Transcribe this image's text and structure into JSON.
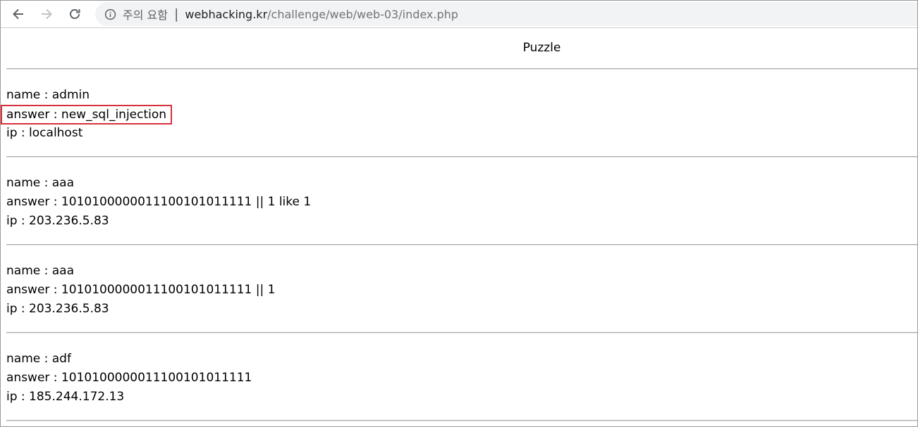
{
  "browser": {
    "security_label": "주의 요함",
    "separator": "|",
    "url_host": "webhacking.kr",
    "url_path": "/challenge/web/web-03/index.php"
  },
  "page": {
    "title": "Puzzle",
    "entries": [
      {
        "name": "name : admin",
        "answer": "answer : new_sql_injection",
        "ip": "ip : localhost",
        "highlighted_field": "answer"
      },
      {
        "name": "name : aaa",
        "answer": "answer : 1010100000011100101011111 || 1 like 1",
        "ip": "ip : 203.236.5.83"
      },
      {
        "name": "name : aaa",
        "answer": "answer : 1010100000011100101011111 || 1",
        "ip": "ip : 203.236.5.83"
      },
      {
        "name": "name : adf",
        "answer": "answer : 1010100000011100101011111",
        "ip": "ip : 185.244.172.13"
      }
    ]
  },
  "colors": {
    "highlight_border": "#d6303b",
    "omnibox_bg": "#f1f3f4"
  }
}
